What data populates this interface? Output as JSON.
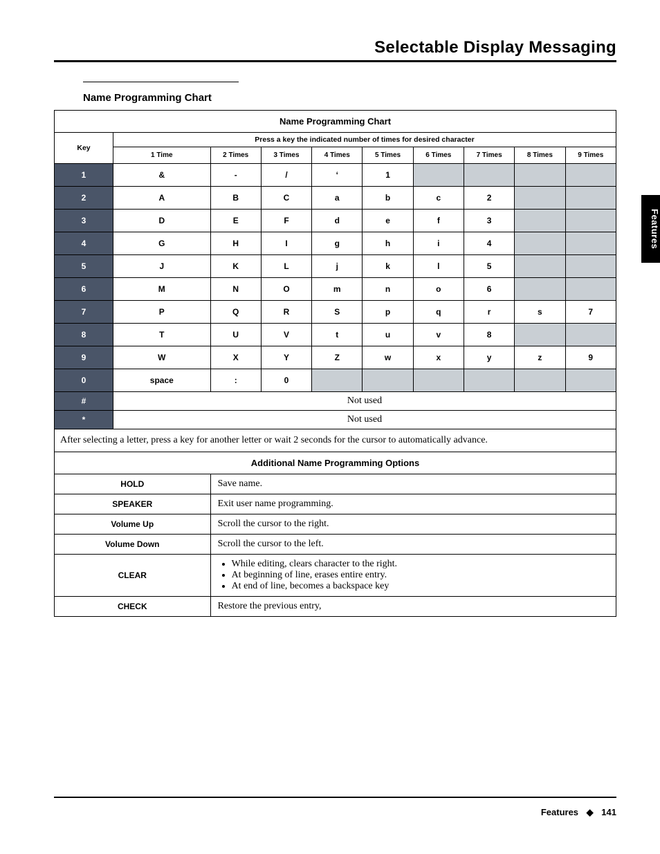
{
  "header": {
    "title": "Selectable Display Messaging"
  },
  "subhead": "Name Programming Chart",
  "sidetab": "Features",
  "table": {
    "title": "Name Programming Chart",
    "instruction": "Press a key the indicated number of times for desired character",
    "key_header": "Key",
    "columns": [
      "1 Time",
      "2 Times",
      "3 Times",
      "4 Times",
      "5 Times",
      "6 Times",
      "7 Times",
      "8 Times",
      "9 Times"
    ],
    "rows": [
      {
        "key": "1",
        "cells": [
          "&",
          "-",
          "/",
          "‘",
          "1"
        ],
        "gray_from": 5
      },
      {
        "key": "2",
        "cells": [
          "A",
          "B",
          "C",
          "a",
          "b",
          "c",
          "2"
        ],
        "gray_from": 7
      },
      {
        "key": "3",
        "cells": [
          "D",
          "E",
          "F",
          "d",
          "e",
          "f",
          "3"
        ],
        "gray_from": 7
      },
      {
        "key": "4",
        "cells": [
          "G",
          "H",
          "I",
          "g",
          "h",
          "i",
          "4"
        ],
        "gray_from": 7
      },
      {
        "key": "5",
        "cells": [
          "J",
          "K",
          "L",
          "j",
          "k",
          "l",
          "5"
        ],
        "gray_from": 7
      },
      {
        "key": "6",
        "cells": [
          "M",
          "N",
          "O",
          "m",
          "n",
          "o",
          "6"
        ],
        "gray_from": 7
      },
      {
        "key": "7",
        "cells": [
          "P",
          "Q",
          "R",
          "S",
          "p",
          "q",
          "r",
          "s",
          "7"
        ],
        "gray_from": 9
      },
      {
        "key": "8",
        "cells": [
          "T",
          "U",
          "V",
          "t",
          "u",
          "v",
          "8"
        ],
        "gray_from": 7
      },
      {
        "key": "9",
        "cells": [
          "W",
          "X",
          "Y",
          "Z",
          "w",
          "x",
          "y",
          "z",
          "9"
        ],
        "gray_from": 9
      },
      {
        "key": "0",
        "cells": [
          "space",
          ":",
          "0"
        ],
        "gray_from": 3
      },
      {
        "key": "#",
        "notused": true
      },
      {
        "key": "*",
        "notused": true
      }
    ],
    "notused_text": "Not used",
    "note": "After selecting a letter, press a key for another letter or wait 2 seconds for the cursor to automatically advance.",
    "options_title": "Additional Name Programming Options",
    "options": [
      {
        "key": "HOLD",
        "desc": "Save name."
      },
      {
        "key": "SPEAKER",
        "desc": "Exit user name programming."
      },
      {
        "key": "Volume Up",
        "desc": "Scroll the cursor to the right."
      },
      {
        "key": "Volume Down",
        "desc": "Scroll the cursor to the left."
      },
      {
        "key": "CLEAR",
        "bullets": [
          "While editing, clears character to the right.",
          "At beginning of line, erases entire entry.",
          "At end of line, becomes a backspace key"
        ]
      },
      {
        "key": "CHECK",
        "desc": "Restore the previous entry,"
      }
    ]
  },
  "footer": {
    "label": "Features",
    "page": "141"
  }
}
